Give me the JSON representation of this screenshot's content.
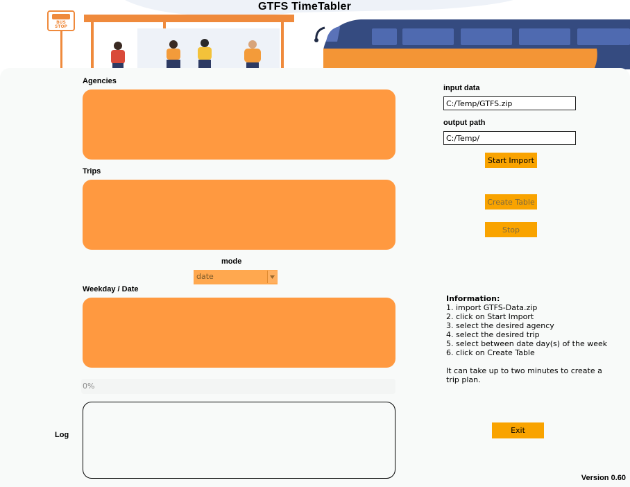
{
  "app": {
    "title": "GTFS TimeTabler",
    "version": "Version 0.60"
  },
  "header": {
    "bus_stop_sign": {
      "line1": "BUS",
      "line2": "STOP"
    }
  },
  "lists": {
    "agencies_label": "Agencies",
    "trips_label": "Trips",
    "weekday_label": "Weekday / Date"
  },
  "mode": {
    "label": "mode",
    "selected": "date"
  },
  "progress": {
    "text": "0%",
    "value": 0
  },
  "log": {
    "label": "Log"
  },
  "import": {
    "input_label": "input data",
    "input_value": "C:/Temp/GTFS.zip",
    "output_label": "output path",
    "output_value": "C:/Temp/",
    "start_import": "Start Import",
    "create_table": "Create Table",
    "stop": "Stop"
  },
  "information": {
    "title": "Information:",
    "steps": [
      "1. import GTFS-Data.zip",
      "2. click on Start Import",
      "3. select the desired agency",
      "4. select the desired trip",
      "5. select between date day(s) of the week",
      "6. click on Create Table"
    ],
    "note_line1": "It can take up to two minutes to create a",
    "note_line2": "trip plan."
  },
  "exit": "Exit",
  "colors": {
    "accent_orange": "#ff9940",
    "button_yellow": "#f9a300",
    "panel_bg": "#f8faf9",
    "train_blue": "#354b80"
  }
}
